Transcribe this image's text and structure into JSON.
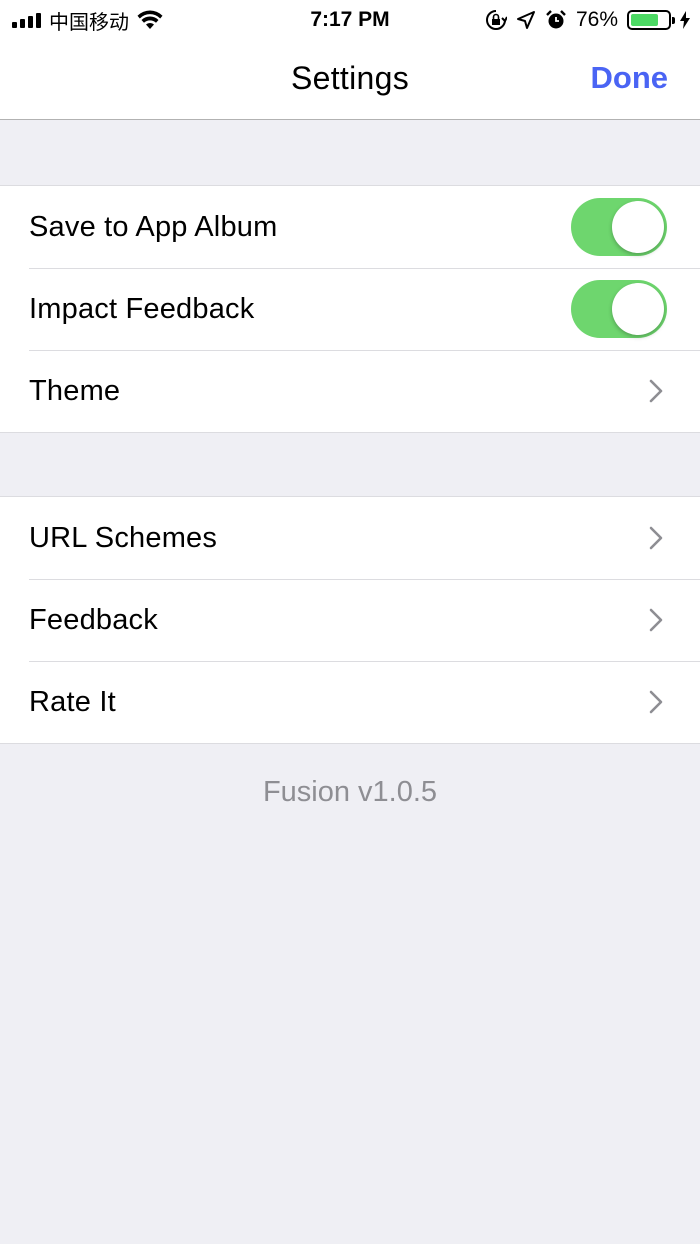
{
  "status_bar": {
    "carrier": "中国移动",
    "time": "7:17 PM",
    "battery_percent": "76%",
    "battery_level": 0.76,
    "icons": [
      "signal-icon",
      "wifi-icon",
      "orientation-lock-icon",
      "location-icon",
      "alarm-icon",
      "battery-icon",
      "charging-icon"
    ]
  },
  "nav": {
    "title": "Settings",
    "done_label": "Done",
    "accent_color": "#4a64f4"
  },
  "groups": [
    {
      "rows": [
        {
          "label": "Save to App Album",
          "control": "toggle",
          "on": true
        },
        {
          "label": "Impact Feedback",
          "control": "toggle",
          "on": true
        },
        {
          "label": "Theme",
          "control": "chevron"
        }
      ]
    },
    {
      "rows": [
        {
          "label": "URL Schemes",
          "control": "chevron"
        },
        {
          "label": "Feedback",
          "control": "chevron"
        },
        {
          "label": "Rate It",
          "control": "chevron"
        }
      ]
    }
  ],
  "footer": {
    "version": "Fusion v1.0.5"
  },
  "colors": {
    "toggle_on": "#6ed66e",
    "background": "#efeff4"
  }
}
